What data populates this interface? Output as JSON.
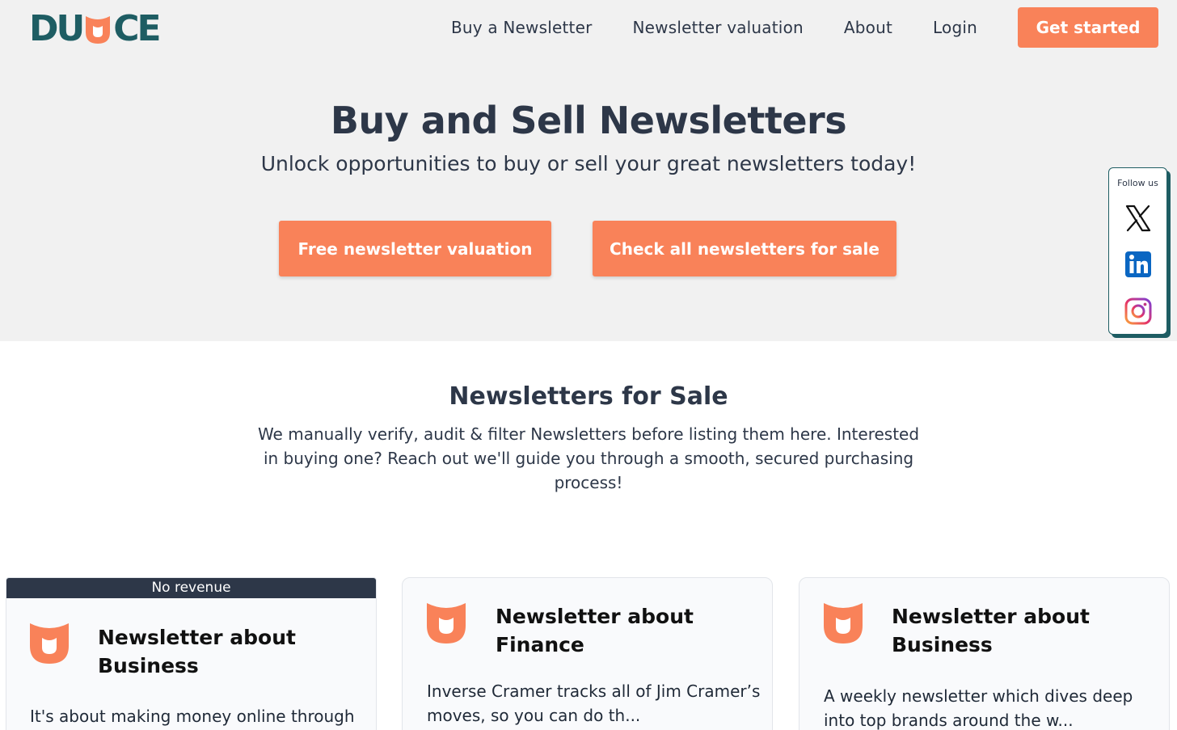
{
  "brand": {
    "logo_left": "DU",
    "logo_right": "CE",
    "accent_color": "#f98259",
    "brand_color": "#1e5d63"
  },
  "nav": {
    "items": [
      {
        "label": "Buy a Newsletter"
      },
      {
        "label": "Newsletter valuation"
      },
      {
        "label": "About"
      },
      {
        "label": "Login"
      }
    ],
    "cta_label": "Get started"
  },
  "hero": {
    "title": "Buy and Sell Newsletters",
    "subtitle": "Unlock opportunities to buy or sell your great newsletters today!",
    "buttons": {
      "valuation": "Free newsletter valuation",
      "for_sale": "Check all newsletters for sale"
    }
  },
  "follow": {
    "label": "Follow us",
    "icons": [
      "x-icon",
      "linkedin-icon",
      "instagram-icon"
    ]
  },
  "section": {
    "title": "Newsletters for Sale",
    "description": "We manually verify, audit & filter Newsletters before listing them here. Interested in buying one? Reach out we'll guide you through a smooth, secured purchasing process!"
  },
  "cards": [
    {
      "badge": "No revenue",
      "title": "Newsletter about Business",
      "text": "It's about making money online through"
    },
    {
      "title": "Newsletter about Finance",
      "text": "Inverse Cramer tracks all of Jim Cramer’s moves, so you can do th..."
    },
    {
      "title": "Newsletter about Business",
      "text": "A weekly newsletter which dives deep into top brands around the w..."
    }
  ]
}
